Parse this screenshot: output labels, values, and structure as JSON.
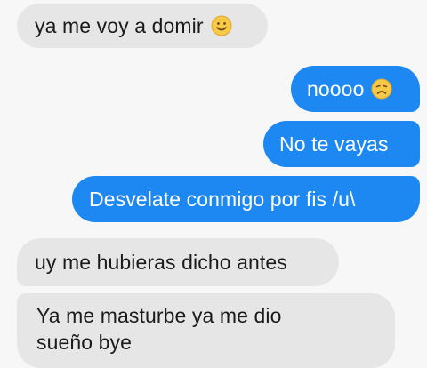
{
  "messages": [
    {
      "direction": "incoming",
      "text": "ya me voy a domir",
      "emoji": "smile-icon"
    },
    {
      "direction": "outgoing",
      "text": "noooo",
      "emoji": "sad-face-icon"
    },
    {
      "direction": "outgoing",
      "text": "No te vayas"
    },
    {
      "direction": "outgoing",
      "text": "Desvelate conmigo por fis /u\\"
    },
    {
      "direction": "incoming",
      "text": "uy me hubieras dicho antes"
    },
    {
      "direction": "incoming",
      "text": "Ya me masturbe ya me dio sueño bye"
    }
  ],
  "colors": {
    "background": "#f7f7f7",
    "incoming_bubble": "#e6e6e6",
    "outgoing_bubble": "#1e88f2",
    "emoji_yellow": "#f7c948"
  }
}
